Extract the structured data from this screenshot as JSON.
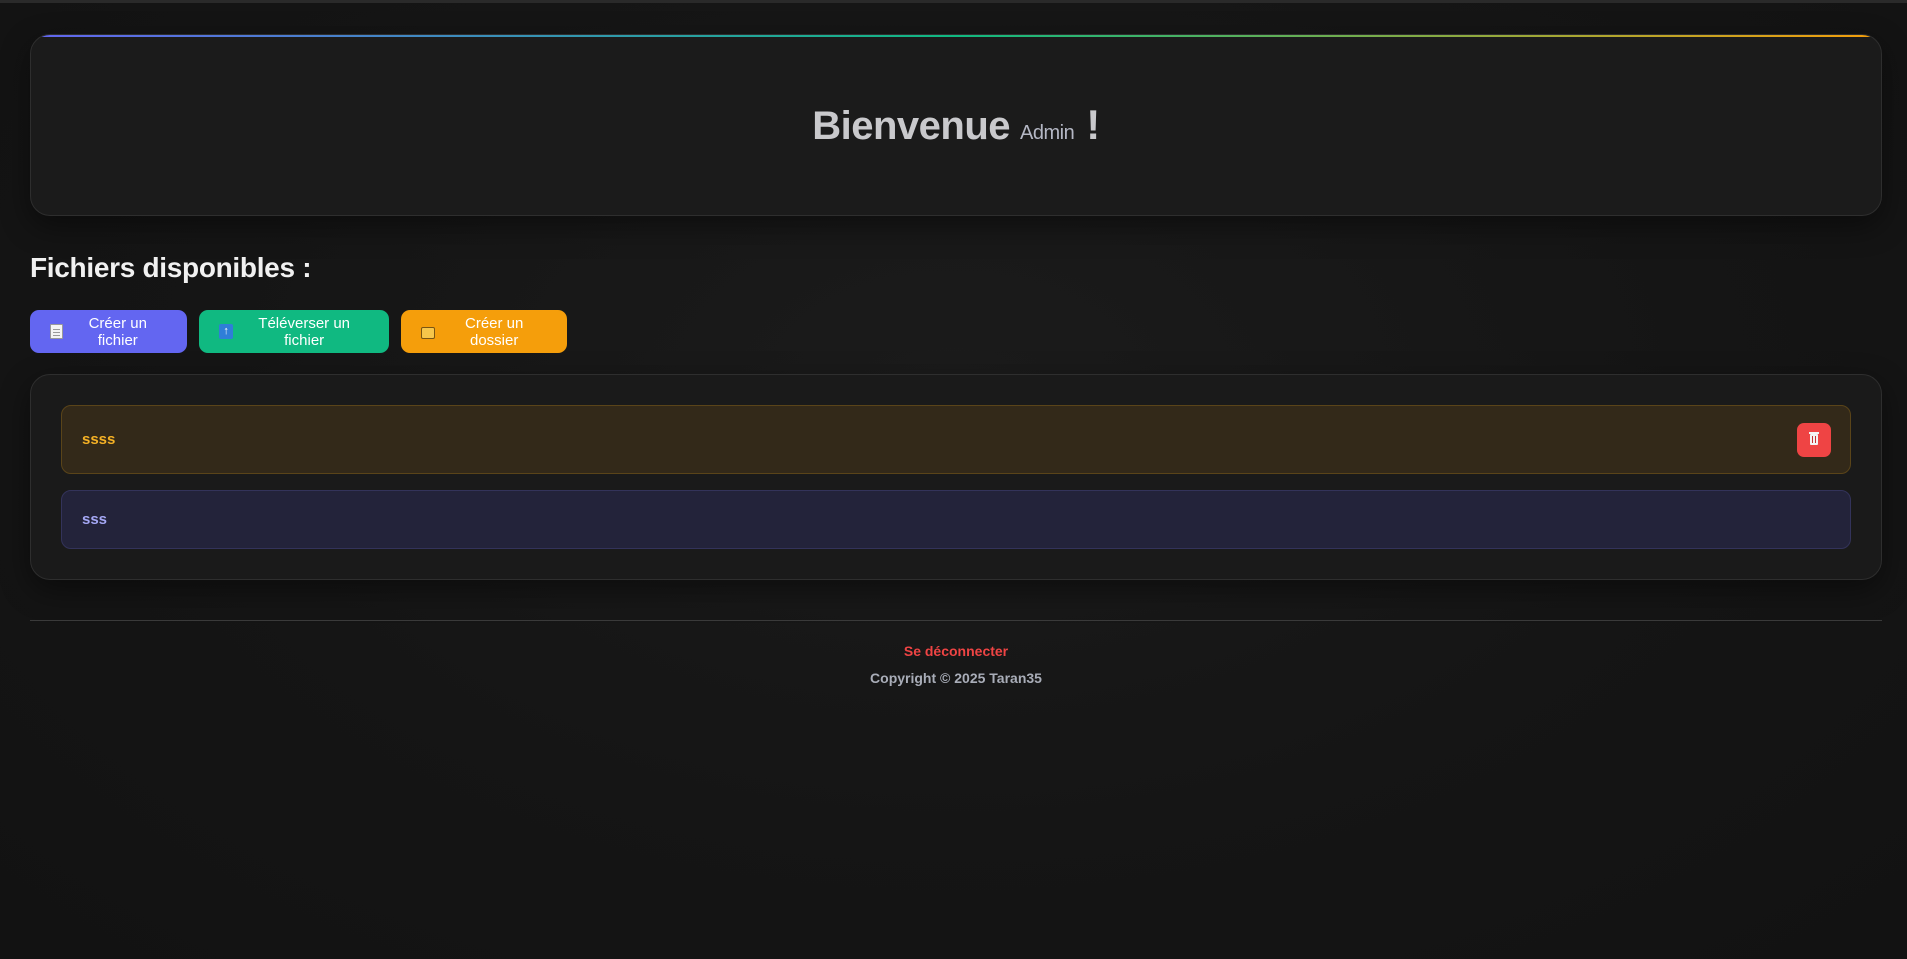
{
  "hero": {
    "greeting": "Bienvenue",
    "username": "Admin",
    "exclamation": "!"
  },
  "files_section": {
    "title": "Fichiers disponibles :"
  },
  "actions": [
    {
      "label": "Créer un fichier",
      "icon": "document-icon",
      "color": "#6366f1"
    },
    {
      "label": "Téléverser un fichier",
      "icon": "upload-icon",
      "color": "#10b981"
    },
    {
      "label": "Créer un dossier",
      "icon": "folder-icon",
      "color": "#f59e0b"
    }
  ],
  "items": [
    {
      "name": "ssss",
      "type": "folder",
      "delete_icon": "trash-icon",
      "color": "#f5b125"
    },
    {
      "name": "sss",
      "type": "file",
      "color": "#a5a8f5"
    }
  ],
  "footer": {
    "logout_label": "Se déconnecter",
    "copyright": "Copyright © 2025 Taran35"
  },
  "colors": {
    "danger": "#ef4444",
    "accent_gradient": [
      "#6366f1",
      "#10b981",
      "#f59e0b"
    ]
  }
}
